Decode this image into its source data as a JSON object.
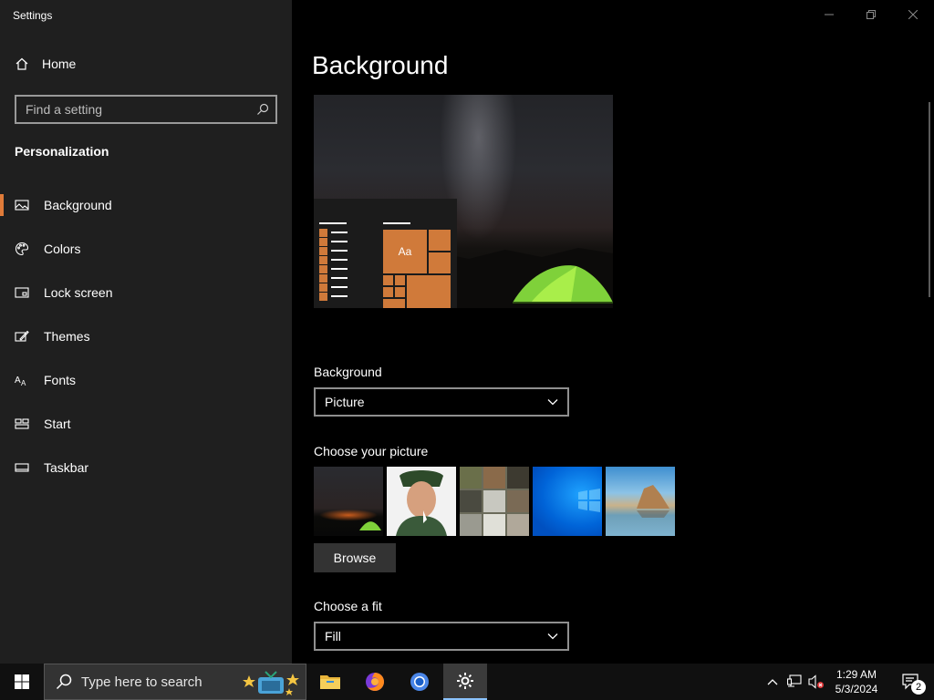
{
  "window": {
    "title": "Settings",
    "controls": [
      "minimize-icon",
      "restore-icon",
      "close-icon"
    ]
  },
  "sidebar": {
    "home_label": "Home",
    "search_placeholder": "Find a setting",
    "section_title": "Personalization",
    "items": [
      {
        "label": "Background",
        "icon": "image-icon",
        "active": true
      },
      {
        "label": "Colors",
        "icon": "palette-icon",
        "active": false
      },
      {
        "label": "Lock screen",
        "icon": "lock-screen-icon",
        "active": false
      },
      {
        "label": "Themes",
        "icon": "themes-icon",
        "active": false
      },
      {
        "label": "Fonts",
        "icon": "fonts-icon",
        "active": false
      },
      {
        "label": "Start",
        "icon": "start-icon",
        "active": false
      },
      {
        "label": "Taskbar",
        "icon": "taskbar-icon",
        "active": false
      }
    ]
  },
  "main": {
    "title": "Background",
    "preview": {
      "sample_text": "Aa"
    },
    "background_label": "Background",
    "background_value": "Picture",
    "choose_picture_label": "Choose your picture",
    "browse_label": "Browse",
    "choose_fit_label": "Choose a fit",
    "fit_value": "Fill"
  },
  "taskbar": {
    "search_placeholder": "Type here to search",
    "apps": [
      "file-explorer-icon",
      "firefox-icon",
      "chromium-icon",
      "settings-gear-icon"
    ],
    "time": "1:29 AM",
    "date": "5/3/2024",
    "notification_count": "2"
  },
  "colors": {
    "accent": "#e07b39",
    "sidebar_bg": "#1f1f1f",
    "main_bg": "#000000",
    "taskbar_bg": "#101010"
  }
}
